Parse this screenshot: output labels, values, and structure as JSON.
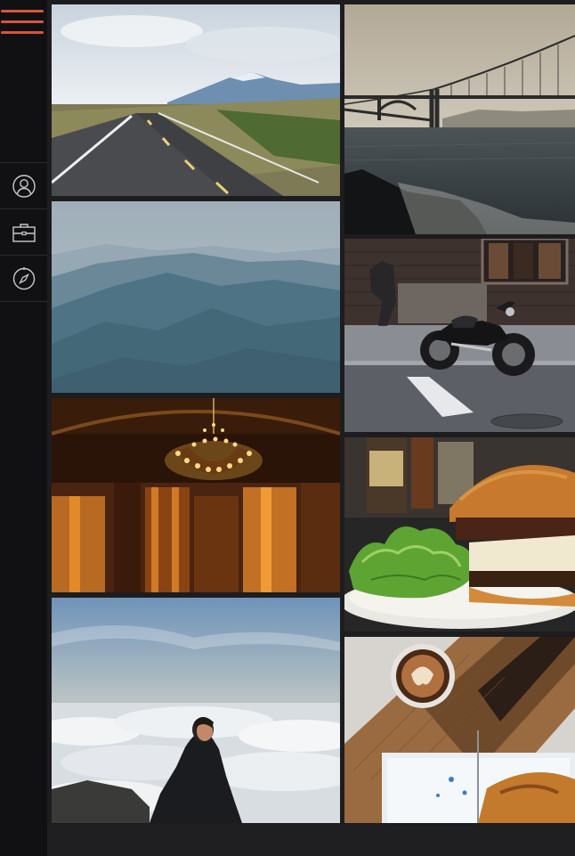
{
  "sidebar": {
    "menu_icon": "hamburger-menu-icon",
    "items": [
      {
        "icon": "user-icon"
      },
      {
        "icon": "briefcase-icon"
      },
      {
        "icon": "compass-icon"
      }
    ]
  },
  "gallery": {
    "photos": [
      {
        "subject": "road"
      },
      {
        "subject": "mountains"
      },
      {
        "subject": "concert-hall"
      },
      {
        "subject": "sea-of-clouds"
      },
      {
        "subject": "bridge"
      },
      {
        "subject": "motorcycle"
      },
      {
        "subject": "burger"
      },
      {
        "subject": "coffee"
      }
    ]
  },
  "colors": {
    "accent": "#d8553e",
    "sidebar_bg": "#111113",
    "page_bg": "#1d1d1f",
    "icon_stroke": "#c9c9c9"
  }
}
